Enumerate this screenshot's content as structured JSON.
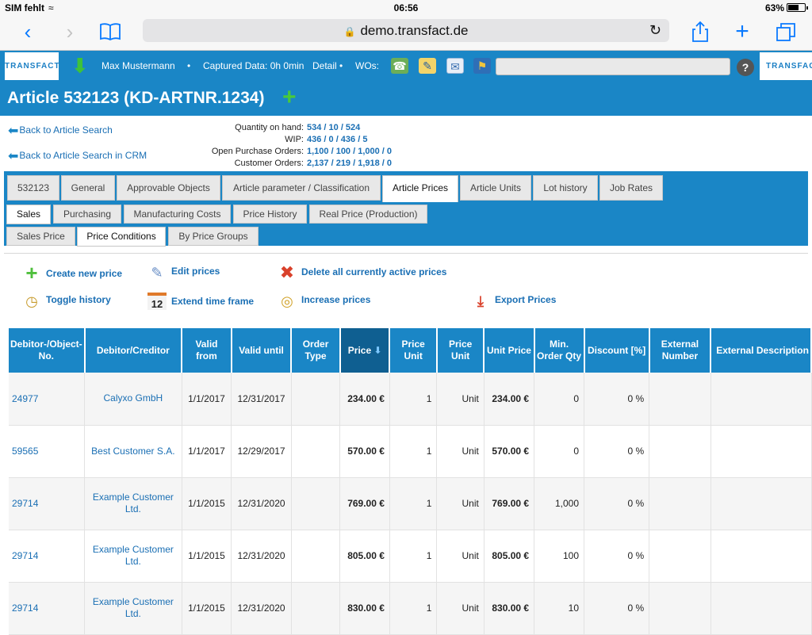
{
  "status_bar": {
    "carrier": "SIM fehlt",
    "time": "06:56",
    "battery": "63%"
  },
  "browser": {
    "url": "demo.transfact.de",
    "back_icon": "chevron-left-icon",
    "forward_icon": "chevron-right-icon"
  },
  "header": {
    "logo": "TRANSFACT",
    "user": "Max Mustermann",
    "captured": "Captured Data: 0h 0min",
    "detail": "Detail",
    "wos_label": "WOs:",
    "help": "?"
  },
  "article": {
    "title": "Article 532123 (KD-ARTNR.1234)"
  },
  "links": {
    "back_search": "Back to Article Search",
    "back_search_crm": "Back to Article Search in CRM"
  },
  "summary": [
    {
      "label": "Quantity on hand:",
      "value": "534 / 10 / 524"
    },
    {
      "label": "WIP:",
      "value": "436 / 0 / 436 / 5"
    },
    {
      "label": "Open Purchase Orders:",
      "value": "1,100 / 100 / 1,000 / 0"
    },
    {
      "label": "Customer Orders:",
      "value": "2,137 / 219 / 1,918 / 0"
    }
  ],
  "tabs": [
    "532123",
    "General",
    "Approvable Objects",
    "Article parameter / Classification",
    "Article Prices",
    "Article Units",
    "Lot history",
    "Job Rates"
  ],
  "subtabs": [
    "Sales",
    "Purchasing",
    "Manufacturing Costs",
    "Price History",
    "Real Price (Production)"
  ],
  "subtabs2": [
    "Sales Price",
    "Price Conditions",
    "By Price Groups"
  ],
  "actions": {
    "create": "Create new price",
    "edit": "Edit prices",
    "delete": "Delete all currently active prices",
    "toggle": "Toggle history",
    "extend": "Extend time frame",
    "increase": "Increase prices",
    "export": "Export Prices",
    "extend_icon_day": "12"
  },
  "table": {
    "headers": [
      "Debitor-/Object-No.",
      "Debitor/Creditor",
      "Valid from",
      "Valid until",
      "Order Type",
      "Price",
      "Price Unit",
      "Price Unit",
      "Unit Price",
      "Min. Order Qty",
      "Discount [%]",
      "External Number",
      "External Description"
    ],
    "rows": [
      [
        "24977",
        "Calyxo GmbH",
        "1/1/2017",
        "12/31/2017",
        "",
        "234.00 €",
        "1",
        "Unit",
        "234.00 €",
        "0",
        "0 %",
        "",
        ""
      ],
      [
        "59565",
        "Best Customer S.A.",
        "1/1/2017",
        "12/29/2017",
        "",
        "570.00 €",
        "1",
        "Unit",
        "570.00 €",
        "0",
        "0 %",
        "",
        ""
      ],
      [
        "29714",
        "Example Customer Ltd.",
        "1/1/2015",
        "12/31/2020",
        "",
        "769.00 €",
        "1",
        "Unit",
        "769.00 €",
        "1,000",
        "0 %",
        "",
        ""
      ],
      [
        "29714",
        "Example Customer Ltd.",
        "1/1/2015",
        "12/31/2020",
        "",
        "805.00 €",
        "1",
        "Unit",
        "805.00 €",
        "100",
        "0 %",
        "",
        ""
      ],
      [
        "29714",
        "Example Customer Ltd.",
        "1/1/2015",
        "12/31/2020",
        "",
        "830.00 €",
        "1",
        "Unit",
        "830.00 €",
        "10",
        "0 %",
        "",
        ""
      ]
    ]
  }
}
